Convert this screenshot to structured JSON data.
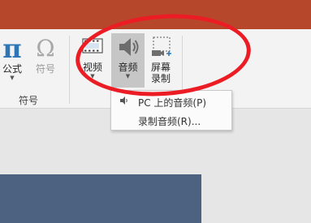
{
  "ribbon": {
    "symbols_group": {
      "label": "符号",
      "equation": {
        "glyph": "π",
        "label": "公式"
      },
      "symbol": {
        "glyph": "Ω",
        "label": "符号"
      }
    },
    "media_group": {
      "video": {
        "label": "视频"
      },
      "audio": {
        "label": "音频"
      },
      "screen_recording": {
        "label_line1": "屏幕",
        "label_line2": "录制"
      }
    }
  },
  "audio_menu": {
    "items": [
      {
        "label": "PC 上的音频(P)",
        "icon": "speaker-icon"
      },
      {
        "label": "录制音频(R)..."
      }
    ]
  },
  "colors": {
    "title_bar": "#b7472a",
    "highlight_oval": "#ec1c24",
    "slide": "#4d6181",
    "equation_icon": "#2e75b6"
  }
}
